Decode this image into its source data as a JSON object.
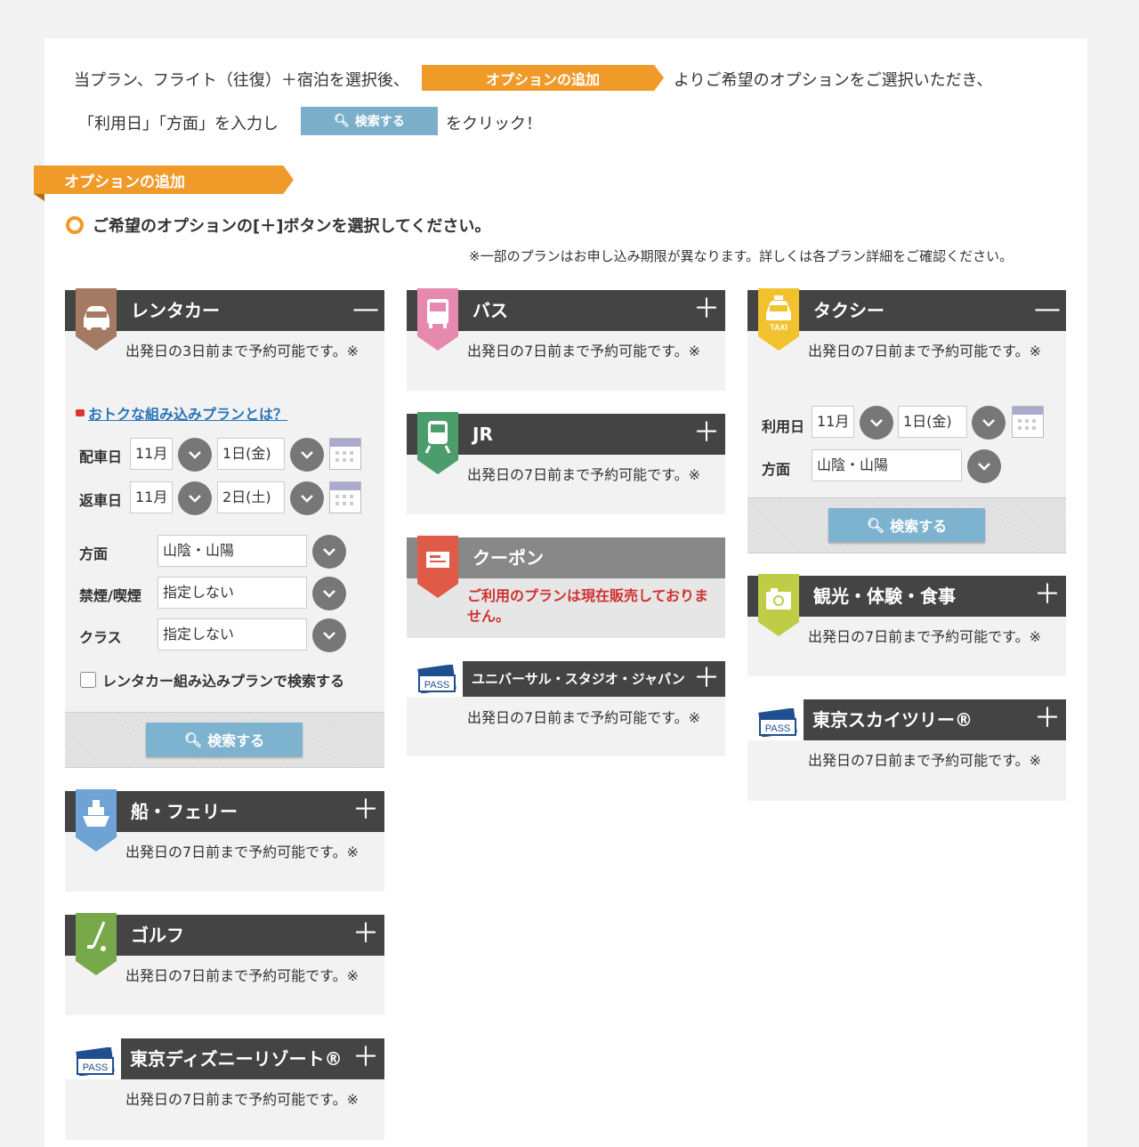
{
  "intro": {
    "line1_a": "当プラン、フライト（往復）＋宿泊を選択後、",
    "line1_btn": "オプションの追加",
    "line1_b": "よりご希望のオプションをご選択いただき、",
    "line2_a": "「利用日」「方面」を入力し",
    "line2_btn": "検索する",
    "line2_b": "をクリック！"
  },
  "section": {
    "title": "オプションの追加",
    "instruction": "ご希望のオプションの[＋]ボタンを選択してください。",
    "note": "※一部のプランはお申し込み期限が異なります。詳しくは各プラン詳細をご確認ください。"
  },
  "rentacar": {
    "title": "レンタカー",
    "toggle": "—",
    "desc": "出発日の3日前まで予約可能です。※",
    "link": "おトクな組み込みプランとは？",
    "pickup_label": "配車日",
    "pickup_month": "11月",
    "pickup_day": "1日(金)",
    "return_label": "返車日",
    "return_month": "11月",
    "return_day": "2日(土)",
    "area_label": "方面",
    "area_value": "山陰・山陽",
    "smoke_label": "禁煙/喫煙",
    "smoke_value": "指定しない",
    "class_label": "クラス",
    "class_value": "指定しない",
    "checkbox_label": "レンタカー組み込みプランで検索する",
    "search": "検索する"
  },
  "ferry": {
    "title": "船・フェリー",
    "toggle": "＋",
    "desc": "出発日の7日前まで予約可能です。※"
  },
  "golf": {
    "title": "ゴルフ",
    "toggle": "＋",
    "desc": "出発日の7日前まで予約可能です。※"
  },
  "disney": {
    "title": "東京ディズニーリゾート®",
    "toggle": "＋",
    "desc": "出発日の7日前まで予約可能です。※",
    "pass": "PASS"
  },
  "bus": {
    "title": "バス",
    "toggle": "＋",
    "desc": "出発日の7日前まで予約可能です。※"
  },
  "jr": {
    "title": "JR",
    "toggle": "＋",
    "desc": "出発日の7日前まで予約可能です。※"
  },
  "coupon": {
    "title": "クーポン",
    "notice": "ご利用のプランは現在販売しておりません。"
  },
  "usj": {
    "title": "ユニバーサル・スタジオ・ジャパン",
    "toggle": "＋",
    "desc": "出発日の7日前まで予約可能です。※",
    "pass": "PASS"
  },
  "taxi": {
    "title": "タクシー",
    "toggle": "—",
    "desc": "出発日の7日前まで予約可能です。※",
    "badge_text": "TAXI",
    "date_label": "利用日",
    "month": "11月",
    "day": "1日(金)",
    "area_label": "方面",
    "area_value": "山陰・山陽",
    "search": "検索する"
  },
  "sightseeing": {
    "title": "観光・体験・食事",
    "toggle": "＋",
    "desc": "出発日の7日前まで予約可能です。※"
  },
  "skytree": {
    "title": "東京スカイツリー®",
    "toggle": "＋",
    "desc": "出発日の7日前まで予約可能です。※",
    "pass": "PASS"
  },
  "colors": {
    "orange": "#f09a2a",
    "header": "#444444",
    "blue_button": "#7eb3cf",
    "rentacar": "#a57a62",
    "bus": "#e58aae",
    "jr": "#4b9e6c",
    "coupon": "#e05a48",
    "taxi": "#f2c12e",
    "ferry": "#6fa3d6",
    "golf": "#77a84a",
    "sightseeing": "#bfcc45"
  }
}
